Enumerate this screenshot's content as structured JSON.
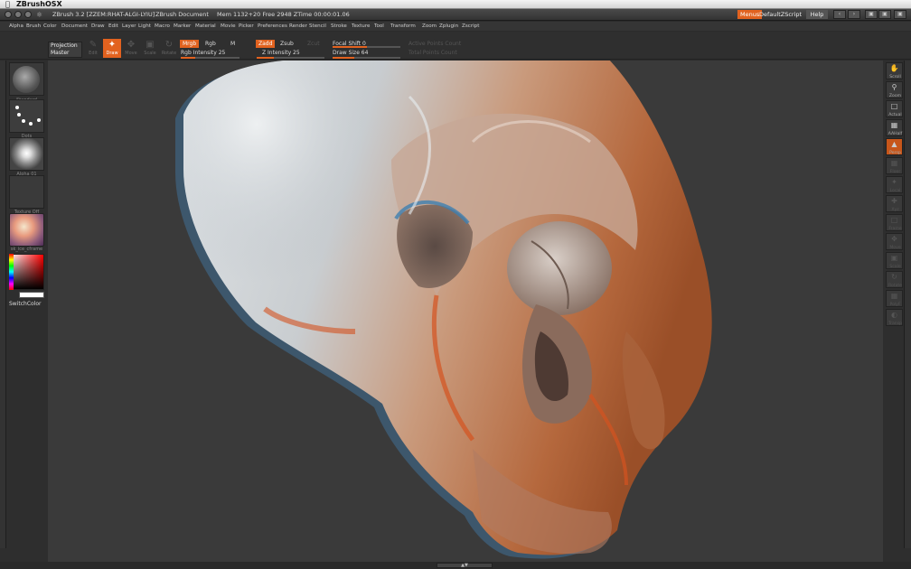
{
  "os": {
    "apple_icon": "apple-icon",
    "app_name": "ZBrushOSX"
  },
  "title_bar": {
    "title": "ZBrush 3.2 [ZZEM:RHAT-ALGI-LYIU]",
    "document": "ZBrush Document",
    "memory": "Mem 1132+20 Free 2948 ZTime 00:00:01.06",
    "menus_label": "Menus",
    "script_label": "DefaultZScript",
    "help_label": "Help"
  },
  "menu": {
    "items": [
      "Alpha",
      "Brush",
      "Color",
      "Document",
      "Draw",
      "Edit",
      "Layer",
      "Light",
      "Macro",
      "Marker",
      "Material",
      "Movie",
      "Picker",
      "Preferences",
      "Render",
      "Stencil",
      "Stroke",
      "Texture",
      "Tool",
      "Transform",
      "Zoom",
      "Zplugin",
      "Zscript"
    ]
  },
  "toolbar": {
    "projection_line1": "Projection",
    "projection_line2": "Master",
    "tools": [
      "Edit",
      "Draw",
      "Move",
      "Scale",
      "Rotate"
    ],
    "active_tool": "Draw",
    "mrgb": "Mrgb",
    "rgb": "Rgb",
    "m": "M",
    "zadd": "Zadd",
    "zsub": "Zsub",
    "zcut": "Zcut",
    "rgb_intensity_label": "Rgb Intensity 25",
    "z_intensity_label": "Z Intensity 25",
    "focal_shift_label": "Focal Shift 0",
    "draw_size_label": "Draw Size 64",
    "active_points": "Active Points Count",
    "total_points": "Total Points Count",
    "rgb_intensity_value": 25,
    "z_intensity_value": 25,
    "focal_shift_value": 0,
    "draw_size_value": 64
  },
  "left_panel": {
    "brush_label": "Standard",
    "stroke_label": "Dots",
    "alpha_label": "Alpha 01",
    "texture_label": "Texture Off",
    "material_label": "sk_ice_cframe",
    "switch_color_label": "SwitchColor"
  },
  "right_panel": {
    "buttons": [
      "Scroll",
      "Zoom",
      "Actual",
      "AAHalf",
      "Persp",
      "Floor",
      "Local",
      "Xyz",
      "Frame",
      "Move",
      "Scale",
      "Rotate",
      "PolyF",
      "Transp"
    ]
  },
  "colors": {
    "accent": "#e2621f",
    "canvas_bg": "#3a3a3a",
    "panel_bg": "#2e2e2e"
  }
}
